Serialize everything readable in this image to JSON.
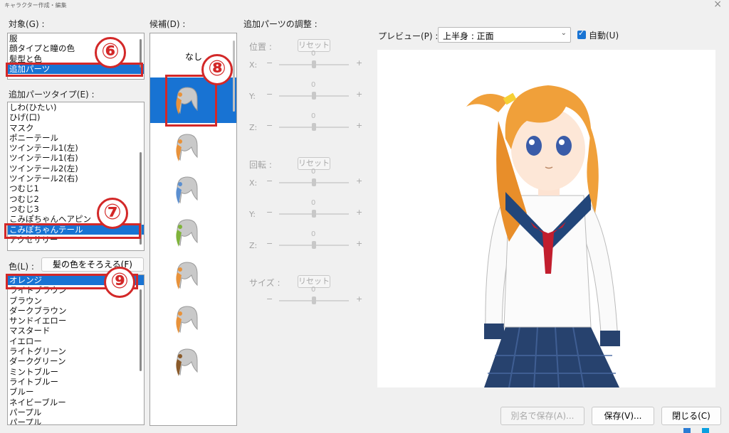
{
  "window": {
    "title": "キャラクター作成・編集"
  },
  "target": {
    "label": "対象(G) :",
    "items": [
      "服",
      "顔タイプと瞳の色",
      "髪型と色",
      "追加パーツ"
    ],
    "selected_index": 3
  },
  "part_type": {
    "label": "追加パーツタイプ(E) :",
    "items": [
      "しわ(ひたい)",
      "ひげ(口)",
      "マスク",
      "ポニーテール",
      "ツインテール1(左)",
      "ツインテール1(右)",
      "ツインテール2(左)",
      "ツインテール2(右)",
      "つむじ1",
      "つむじ2",
      "つむじ3",
      "こみぽちゃんヘアピン",
      "こみぽちゃんテール",
      "アクセサリー"
    ],
    "selected_index": 12
  },
  "color": {
    "label": "色(L) :",
    "match_hair_button": "髪の色をそろえる(F)",
    "items": [
      "オレンジ",
      "ライトブラウン",
      "ブラウン",
      "ダークブラウン",
      "サンドイエロー",
      "マスタード",
      "イエロー",
      "ライトグリーン",
      "ダークグリーン",
      "ミントブルー",
      "ライトブルー",
      "ブルー",
      "ネイビーブルー",
      "パープル",
      "パープル"
    ],
    "selected_index": 0
  },
  "candidates": {
    "label": "候補(D) :",
    "none_label": "なし",
    "thumbnail_icons": [
      "hair-part-icon",
      "hair-part-orange-icon",
      "hair-part-blue-icon",
      "hair-part-green-icon",
      "hair-part-orange-icon",
      "hair-part-orange-icon",
      "hair-part-brown-icon"
    ],
    "selected_index": 1
  },
  "adjust": {
    "title": "追加パーツの調整 :",
    "position_label": "位置 :",
    "rotation_label": "回転 :",
    "size_label": "サイズ :",
    "reset_label": "リセット",
    "axes": [
      "X:",
      "Y:",
      "Z:"
    ],
    "minus": "−",
    "plus": "+",
    "values": [
      "0",
      "0",
      "0",
      "0",
      "0",
      "0",
      "0"
    ]
  },
  "preview": {
    "label": "プレビュー(P) :",
    "select_value": "上半身 : 正面",
    "auto_label": "自動(U)",
    "auto_checked": true
  },
  "footer": {
    "save_as": "別名で保存(A)...",
    "save": "保存(V)...",
    "close": "閉じる(C)"
  },
  "annotations": [
    "⑥",
    "⑦",
    "⑧",
    "⑨"
  ],
  "colors": {
    "selection": "#1873d3",
    "marker": "#d32828"
  }
}
